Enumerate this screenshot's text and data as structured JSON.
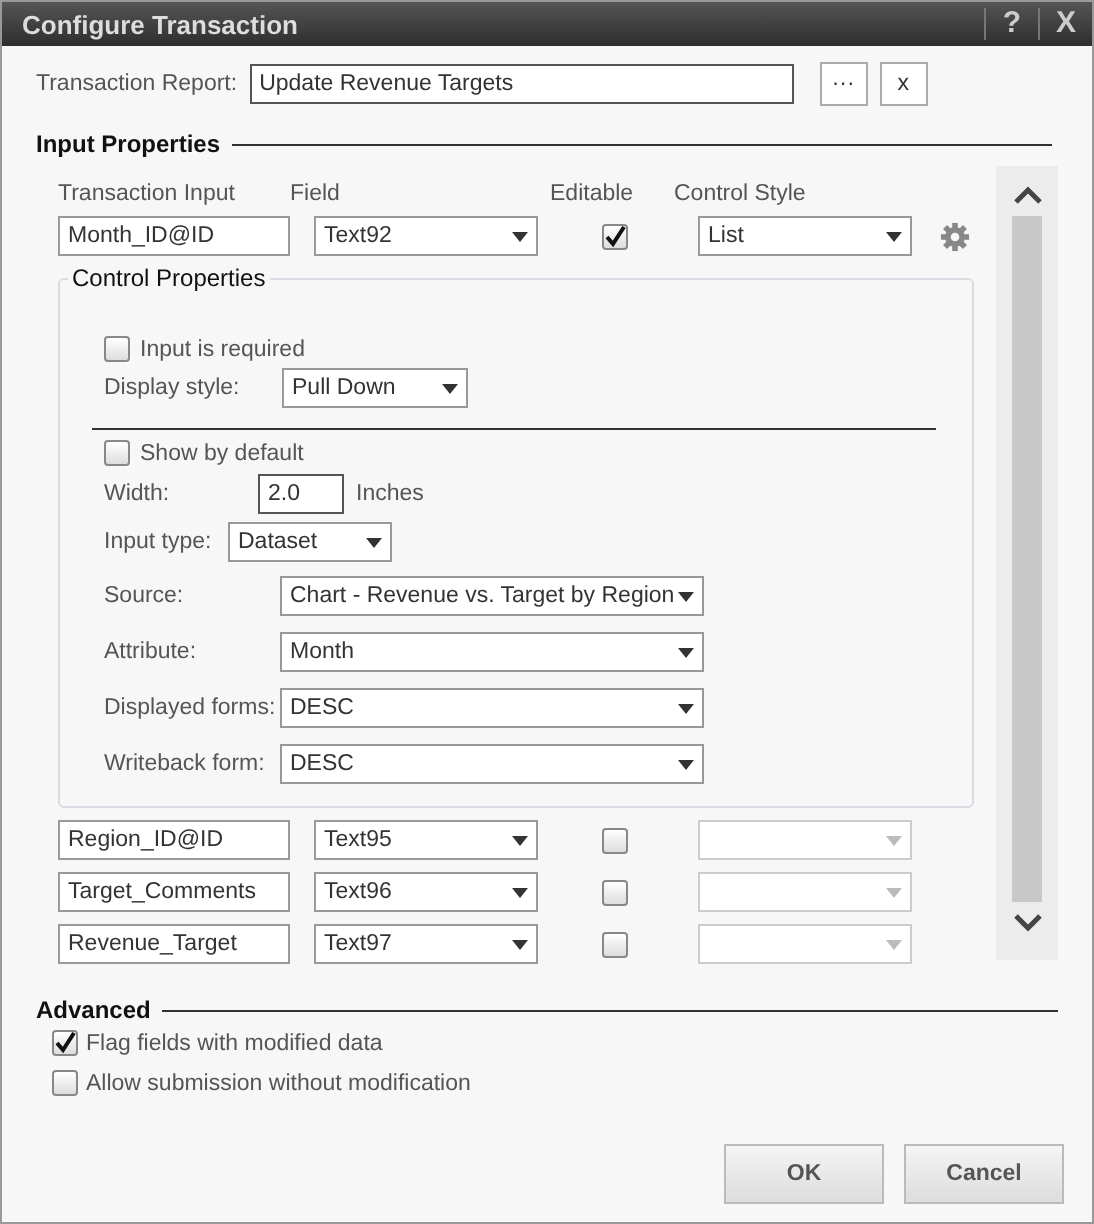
{
  "window": {
    "title": "Configure Transaction",
    "controls": [
      "?",
      "X"
    ]
  },
  "transaction_report": {
    "label": "Transaction Report:",
    "value": "Update Revenue Targets",
    "buttons": [
      "···",
      "x"
    ]
  },
  "input_properties": {
    "title": "Input Properties",
    "columns": [
      "Transaction Input",
      "Field",
      "Editable",
      "Control Style"
    ],
    "rows": [
      {
        "input": "Month_ID@ID",
        "field": "Text92",
        "editable": true,
        "control_style": "List",
        "control_style_disabled": false,
        "expanded": true
      },
      {
        "input": "Region_ID@ID",
        "field": "Text95",
        "editable": false,
        "control_style_disabled": true,
        "expanded": false
      },
      {
        "input": "Target_Comments",
        "field": "Text96",
        "editable": false,
        "control_style_disabled": true,
        "expanded": false
      },
      {
        "input": "Revenue_Target",
        "field": "Text97",
        "editable": false,
        "control_style_disabled": true,
        "expanded": false
      }
    ]
  },
  "control_properties": {
    "title": "Control Properties",
    "input_required": {
      "label": "Input is required",
      "checked": false
    },
    "display_style": {
      "label": "Display style:",
      "value": "Pull Down"
    },
    "show_by_default": {
      "label": "Show by default",
      "checked": false
    },
    "width": {
      "label": "Width:",
      "value": "2.0",
      "unit": "Inches"
    },
    "input_type": {
      "label": "Input type:",
      "value": "Dataset"
    },
    "selects": [
      {
        "label": "Source:",
        "value": "Chart - Revenue vs. Target by Region"
      },
      {
        "label": "Attribute:",
        "value": "Month"
      },
      {
        "label": "Displayed forms:",
        "value": "DESC"
      },
      {
        "label": "Writeback form:",
        "value": "DESC"
      }
    ]
  },
  "advanced": {
    "title": "Advanced",
    "options": [
      {
        "label": "Flag fields with modified data",
        "checked": true
      },
      {
        "label": "Allow submission without modification",
        "checked": false
      }
    ]
  },
  "buttons": [
    "OK",
    "Cancel"
  ]
}
